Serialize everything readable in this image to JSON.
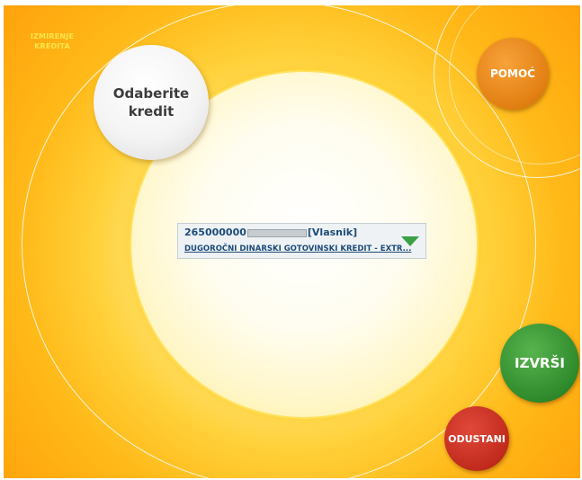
{
  "app": {
    "title": "IZMIRENJE KREDITA"
  },
  "prompt": {
    "text": "Odaberite kredit"
  },
  "buttons": {
    "help": "POMOĆ",
    "execute": "IZVRŠI",
    "cancel": "ODUSTANI"
  },
  "credit_select": {
    "account_prefix": "265000000",
    "owner_role": "[Vlasnik]",
    "credit_name": "DUGOROČNI DINARSKI GOTOVINSKI KREDIT - EXTR..."
  },
  "colors": {
    "help": "#e27f12",
    "execute": "#2f8a2b",
    "cancel": "#c12b1d",
    "accent_text": "#1d4b7a"
  }
}
